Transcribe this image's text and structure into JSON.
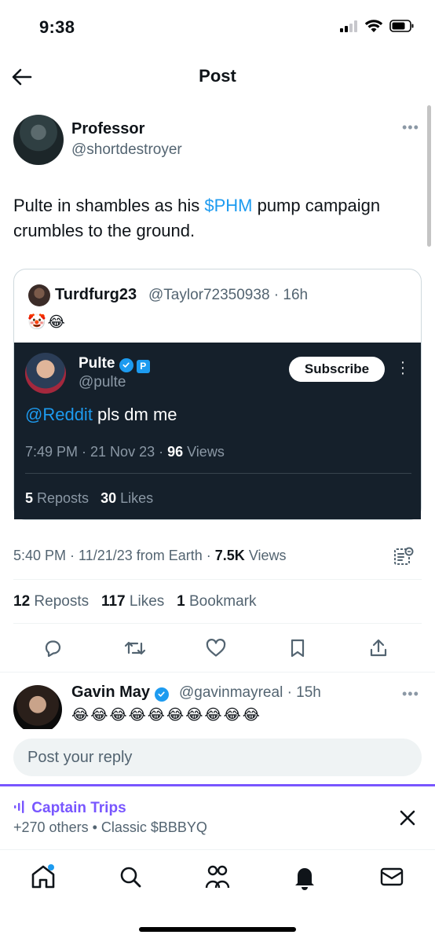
{
  "status_bar": {
    "time": "9:38"
  },
  "header": {
    "title": "Post"
  },
  "post": {
    "display_name": "Professor",
    "handle": "@shortdestroyer",
    "text_before": "Pulte in shambles as his ",
    "cashtag": "$PHM",
    "text_after": " pump campaign crumbles to the ground.",
    "timestamp": "5:40 PM · 11/21/23 from Earth · ",
    "views_count": "7.5K",
    "views_label": " Views",
    "reposts_count": "12",
    "reposts_label": " Reposts",
    "likes_count": "117",
    "likes_label": " Likes",
    "bookmarks_count": "1",
    "bookmarks_label": " Bookmark"
  },
  "quote": {
    "display_name": "Turdfurg23",
    "handle": "@Taylor72350938 · 16h",
    "emoji": "🤡😂"
  },
  "embedded_tweet": {
    "display_name": "Pulte",
    "badge": "P",
    "handle": "@pulte",
    "subscribe_label": "Subscribe",
    "mention": "@Reddit",
    "text": " pls dm me",
    "timestamp": "7:49 PM · 21 Nov 23 · ",
    "views_count": "96",
    "views_label": " Views",
    "reposts_count": "5",
    "reposts_label": " Reposts",
    "likes_count": "30",
    "likes_label": " Likes"
  },
  "reply": {
    "display_name": "Gavin May",
    "handle": "@gavinmayreal · 15h",
    "emoji": "😂😂😂😂😂😂😂😂😂😂"
  },
  "reply_input": {
    "placeholder": "Post your reply"
  },
  "space": {
    "title": "Captain Trips",
    "subtitle": "+270 others • Classic $BBBYQ"
  },
  "colors": {
    "accent": "#1d9bf0",
    "space_purple": "#7856ff",
    "dark_card": "#15202b"
  }
}
